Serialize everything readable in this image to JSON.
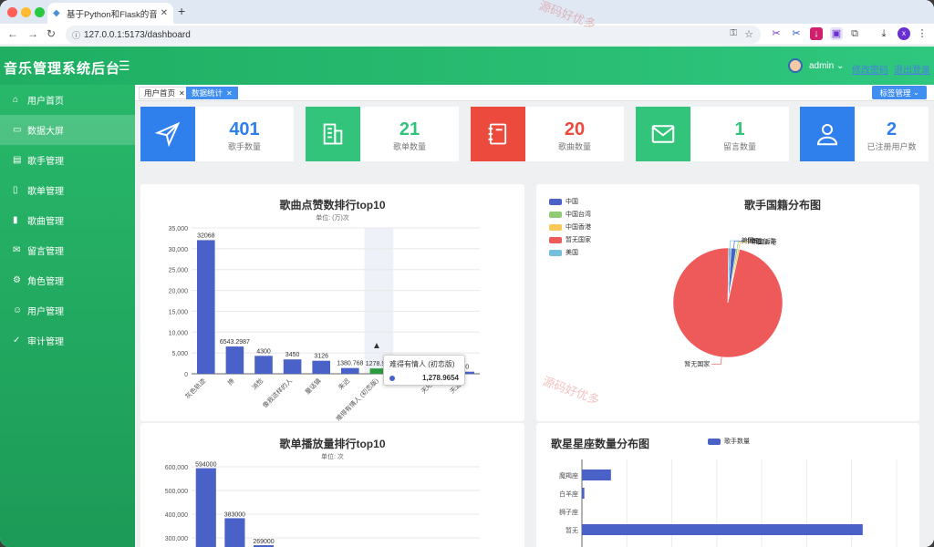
{
  "browser": {
    "tab_title": "基于Python和Flask的音乐平台",
    "url": "127.0.0.1:5173/dashboard",
    "profile_initial": "x"
  },
  "header": {
    "title": "音乐管理系统后台",
    "user": "admin",
    "link1": "修改密码",
    "link2": "退出登录"
  },
  "sidebar": {
    "items": [
      {
        "label": "用户首页",
        "icon": "home-icon"
      },
      {
        "label": "数据大屏",
        "icon": "monitor-icon"
      },
      {
        "label": "歌手管理",
        "icon": "singer-icon"
      },
      {
        "label": "歌单管理",
        "icon": "playlist-icon"
      },
      {
        "label": "歌曲管理",
        "icon": "song-icon"
      },
      {
        "label": "留言管理",
        "icon": "message-icon"
      },
      {
        "label": "角色管理",
        "icon": "role-icon"
      },
      {
        "label": "用户管理",
        "icon": "user-icon"
      },
      {
        "label": "审计管理",
        "icon": "audit-icon"
      }
    ]
  },
  "tags": {
    "items": [
      "用户首页",
      "数据统计"
    ],
    "manage": "标签管理"
  },
  "stats": [
    {
      "num": "401",
      "label": "歌手数量",
      "color": "#2f80ed"
    },
    {
      "num": "21",
      "label": "歌单数量",
      "color": "#33c47b"
    },
    {
      "num": "20",
      "label": "歌曲数量",
      "color": "#ec4a3c"
    },
    {
      "num": "1",
      "label": "留言数量",
      "color": "#33c47b"
    },
    {
      "num": "2",
      "label": "已注册用户数",
      "color": "#2f80ed"
    }
  ],
  "chart_data": [
    {
      "type": "bar",
      "title": "歌曲点赞数排行top10",
      "subtitle": "单位: (万)次",
      "categories": [
        "灰色轨迹",
        "搀",
        "消愁",
        "像我这样的人",
        "童话镇",
        "朱迟",
        "难得有情人 (初恋版)",
        "",
        "天地...",
        "天涯..."
      ],
      "values": [
        32068,
        6543.2987,
        4300,
        3450,
        3126,
        1380.7684,
        1278.9654,
        900,
        700,
        500
      ],
      "value_labels": [
        "32068",
        "6543.2987",
        "4300",
        "3450",
        "3126",
        "1380.768",
        "1278.965",
        "",
        "",
        "90"
      ],
      "yticks": [
        "35,000",
        "30,000",
        "25,000",
        "20,000",
        "15,000",
        "10,000",
        "5,000",
        "0"
      ],
      "ylim": [
        0,
        35000
      ],
      "tooltip": {
        "name": "难得有情人 (初恋版)",
        "value": "1,278.9654"
      }
    },
    {
      "type": "pie",
      "title": "歌手国籍分布图",
      "slices": [
        {
          "name": "中国",
          "value": 6,
          "color": "#4a62c8"
        },
        {
          "name": "中国台湾",
          "value": 2,
          "color": "#91cc75"
        },
        {
          "name": "中国香港",
          "value": 2,
          "color": "#fac858"
        },
        {
          "name": "暂无国家",
          "value": 388,
          "color": "#ee5a5a"
        },
        {
          "name": "美国",
          "value": 3,
          "color": "#73c0de"
        }
      ]
    },
    {
      "type": "bar",
      "title": "歌单播放量排行top10",
      "subtitle": "单位: 次",
      "values": [
        594000,
        383000,
        269000
      ],
      "value_labels": [
        "594000",
        "383000",
        "269000"
      ],
      "yticks": [
        "600,000",
        "500,000",
        "400,000",
        "300,000"
      ],
      "ylim": [
        0,
        600000
      ]
    },
    {
      "type": "bar",
      "title": "歌星星座数量分布图",
      "legend": "歌手数量",
      "categories": [
        "魔羯座",
        "白羊座",
        "狮子座",
        "暂无"
      ],
      "values": [
        12,
        1,
        0,
        116
      ],
      "xlim": [
        0,
        130
      ]
    }
  ],
  "watermark": "源码好优多",
  "colors": {
    "bar": "#4a62c8",
    "highlight": "#2d9a3f",
    "green": "#25b066"
  }
}
